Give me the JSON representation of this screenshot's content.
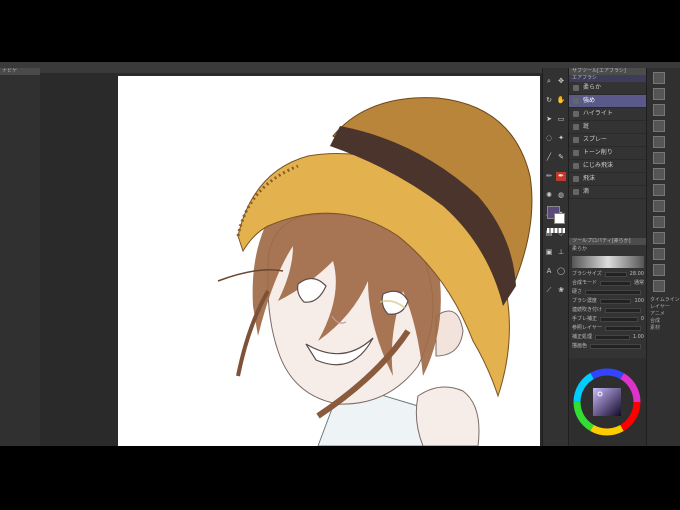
{
  "left_panel": {
    "tab_label": "ナビゲ"
  },
  "toolbar": {
    "tools": [
      {
        "name": "zoom-tool-icon",
        "glyph": "⌕"
      },
      {
        "name": "move-tool-icon",
        "glyph": "✥"
      },
      {
        "name": "rotate-tool-icon",
        "glyph": "↻"
      },
      {
        "name": "hand-tool-icon",
        "glyph": "✋"
      },
      {
        "name": "pointer-tool-icon",
        "glyph": "➤"
      },
      {
        "name": "select-tool-icon",
        "glyph": "▭"
      },
      {
        "name": "lasso-tool-icon",
        "glyph": "◌"
      },
      {
        "name": "wand-tool-icon",
        "glyph": "✦"
      },
      {
        "name": "eyedropper-tool-icon",
        "glyph": "╱"
      },
      {
        "name": "pen-tool-icon",
        "glyph": "✎"
      },
      {
        "name": "pencil-tool-icon",
        "glyph": "✏"
      },
      {
        "name": "brush-tool-icon",
        "glyph": "✒"
      },
      {
        "name": "airbrush-tool-icon",
        "glyph": "✺"
      },
      {
        "name": "blend-tool-icon",
        "glyph": "◍"
      },
      {
        "name": "eraser-tool-icon",
        "glyph": "▱"
      },
      {
        "name": "fill-tool-icon",
        "glyph": "◆"
      },
      {
        "name": "gradient-tool-icon",
        "glyph": "▤"
      },
      {
        "name": "figure-tool-icon",
        "glyph": "◇"
      },
      {
        "name": "frame-tool-icon",
        "glyph": "▣"
      },
      {
        "name": "ruler-tool-icon",
        "glyph": "⊥"
      },
      {
        "name": "text-tool-icon",
        "glyph": "A"
      },
      {
        "name": "balloon-tool-icon",
        "glyph": "◯"
      },
      {
        "name": "line-fix-tool-icon",
        "glyph": "⟋"
      },
      {
        "name": "decoration-tool-icon",
        "glyph": "❀"
      }
    ],
    "active_tool_index": 11
  },
  "sub_tool": {
    "panel_title": "サブツール[エアブラシ]",
    "group_tab": "エアブラシ",
    "items": [
      "柔らか",
      "強め",
      "ハイライト",
      "斑",
      "スプレー",
      "トーン削り",
      "にじみ飛沫",
      "飛沫",
      "滴"
    ],
    "selected_index": 1
  },
  "tool_property": {
    "panel_title": "ツールプロパティ[柔らか]",
    "brush_name": "柔らか",
    "rows": [
      {
        "label": "ブラシサイズ",
        "value": "28.00"
      },
      {
        "label": "合成モード",
        "value": "通常"
      },
      {
        "label": "硬さ",
        "value": ""
      },
      {
        "label": "ブラシ濃度",
        "value": "100"
      },
      {
        "label": "連続吹き付け",
        "value": ""
      },
      {
        "label": "手ブレ補正",
        "value": "0"
      },
      {
        "label": "参照レイヤー",
        "value": ""
      },
      {
        "label": "補正処理",
        "value": "1.00"
      },
      {
        "label": "描画色",
        "value": ""
      }
    ]
  },
  "colors": {
    "main": "#5a4a7a",
    "sub": "#ffffff",
    "hat": "#b9853a",
    "band": "#4a342b",
    "hair": "#a06a45",
    "skin": "#f6ece8"
  },
  "right_panel": {
    "labels": [
      "タイムライン",
      "レイヤー",
      "アニメ",
      "合成",
      "素材"
    ]
  }
}
